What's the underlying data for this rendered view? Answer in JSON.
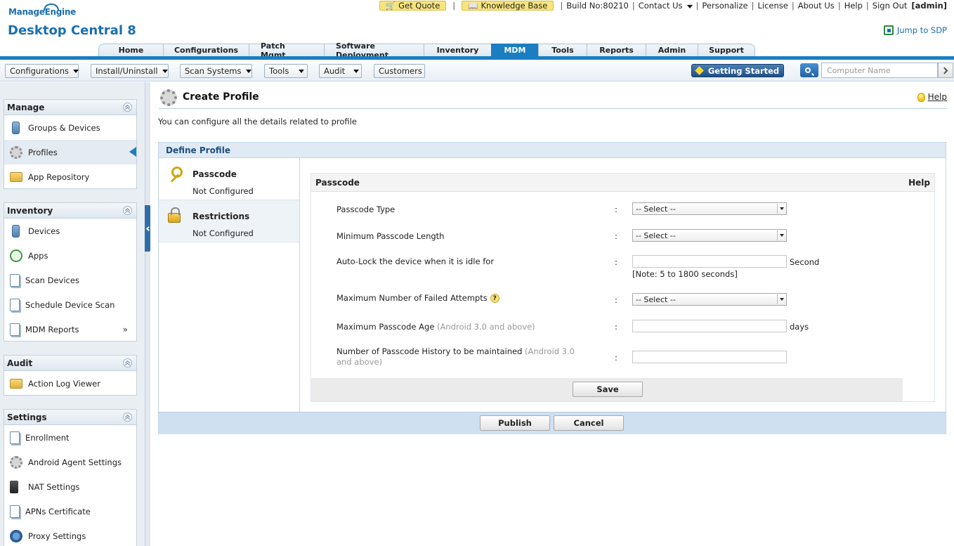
{
  "header": {
    "brand_small": "ManageEngine",
    "brand_big": "Desktop Central 8",
    "get_quote": "Get Quote",
    "knowledge_base": "Knowledge Base",
    "build": "Build No:80210",
    "contact_us": "Contact Us",
    "personalize": "Personalize",
    "license": "License",
    "about_us": "About Us",
    "help": "Help",
    "sign_out": "Sign Out",
    "user": "[admin]",
    "jump_to_sdp": "Jump to SDP"
  },
  "main_tabs": [
    "Home",
    "Configurations",
    "Patch Mgmt",
    "Software Deployment",
    "Inventory",
    "MDM",
    "Tools",
    "Reports",
    "Admin",
    "Support"
  ],
  "active_tab": "MDM",
  "subbar": {
    "configurations": "Configurations",
    "install_uninstall": "Install/Uninstall",
    "scan_systems": "Scan Systems",
    "tools": "Tools",
    "audit": "Audit",
    "customers": "Customers",
    "getting_started": "Getting Started",
    "search_placeholder": "Computer Name"
  },
  "sidebar": {
    "manage": {
      "title": "Manage",
      "items": [
        "Groups & Devices",
        "Profiles",
        "App Repository"
      ]
    },
    "inventory": {
      "title": "Inventory",
      "items": [
        "Devices",
        "Apps",
        "Scan Devices",
        "Schedule Device Scan",
        "MDM Reports"
      ]
    },
    "audit": {
      "title": "Audit",
      "items": [
        "Action Log Viewer"
      ]
    },
    "settings": {
      "title": "Settings",
      "items": [
        "Enrollment",
        "Android Agent Settings",
        "NAT Settings",
        "APNs Certificate",
        "Proxy Settings"
      ]
    },
    "more_glyph": "»"
  },
  "content": {
    "title": "Create Profile",
    "help": "Help",
    "subtitle": "You can configure all the details related to profile",
    "define_profile": "Define Profile",
    "nav": [
      {
        "title": "Passcode",
        "status": "Not Configured"
      },
      {
        "title": "Restrictions",
        "status": "Not Configured"
      }
    ],
    "panel": {
      "title": "Passcode",
      "help": "Help",
      "colon": ":",
      "fields": {
        "passcode_type": {
          "label": "Passcode Type",
          "value": "-- Select --"
        },
        "min_length": {
          "label": "Minimum Passcode Length",
          "value": "-- Select --"
        },
        "auto_lock": {
          "label": "Auto-Lock the device when it is idle for",
          "unit": "Second",
          "note": "[Note: 5 to 1800 seconds]"
        },
        "max_failed": {
          "label": "Maximum Number of Failed Attempts",
          "value": "-- Select --",
          "qmark": "?"
        },
        "max_age": {
          "label": "Maximum Passcode Age",
          "hint": "(Android 3.0 and above)",
          "unit": "days"
        },
        "history": {
          "label": "Number of Passcode History to be maintained",
          "hint": "(Android 3.0 and above)"
        }
      },
      "save": "Save"
    },
    "publish": "Publish",
    "cancel": "Cancel"
  }
}
